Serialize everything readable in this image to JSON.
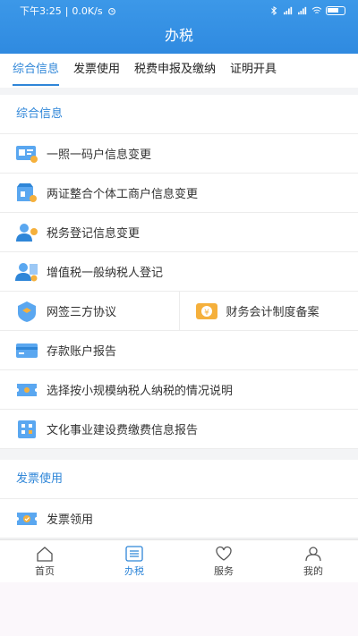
{
  "status": {
    "time": "下午3:25",
    "speed": "0.0K/s",
    "sep": "|"
  },
  "header": {
    "title": "办税"
  },
  "tabs": [
    "综合信息",
    "发票使用",
    "税费申报及缴纳",
    "证明开具"
  ],
  "sections": {
    "general": {
      "title": "综合信息",
      "items": [
        "一照一码户信息变更",
        "两证整合个体工商户信息变更",
        "税务登记信息变更",
        "增值税一般纳税人登记",
        "网签三方协议",
        "财务会计制度备案",
        "存款账户报告",
        "选择按小规模纳税人纳税的情况说明",
        "文化事业建设费缴费信息报告"
      ]
    },
    "invoice": {
      "title": "发票使用",
      "items": [
        "发票领用"
      ]
    }
  },
  "nav": [
    "首页",
    "办税",
    "服务",
    "我的"
  ],
  "colors": {
    "brand": "#2f86d8",
    "header": "#3a96e6"
  }
}
